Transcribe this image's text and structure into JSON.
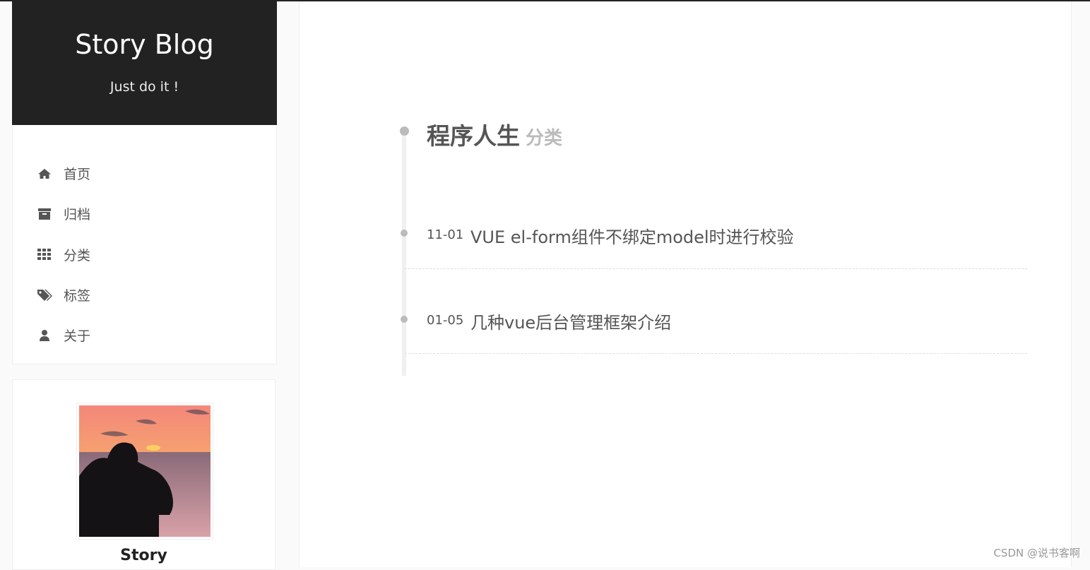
{
  "brand": {
    "title": "Story Blog",
    "subtitle": "Just do it !"
  },
  "menu": [
    {
      "label": "首页",
      "icon": "home-icon"
    },
    {
      "label": "归档",
      "icon": "archive-icon"
    },
    {
      "label": "分类",
      "icon": "grid-icon"
    },
    {
      "label": "标签",
      "icon": "tags-icon"
    },
    {
      "label": "关于",
      "icon": "user-icon"
    }
  ],
  "profile": {
    "name": "Story"
  },
  "category": {
    "name": "程序人生",
    "suffix": "分类"
  },
  "posts": [
    {
      "date": "11-01",
      "title": "VUE el-form组件不绑定model时进行校验"
    },
    {
      "date": "01-05",
      "title": "几种vue后台管理框架介绍"
    }
  ],
  "watermark": "CSDN @说书客啊"
}
